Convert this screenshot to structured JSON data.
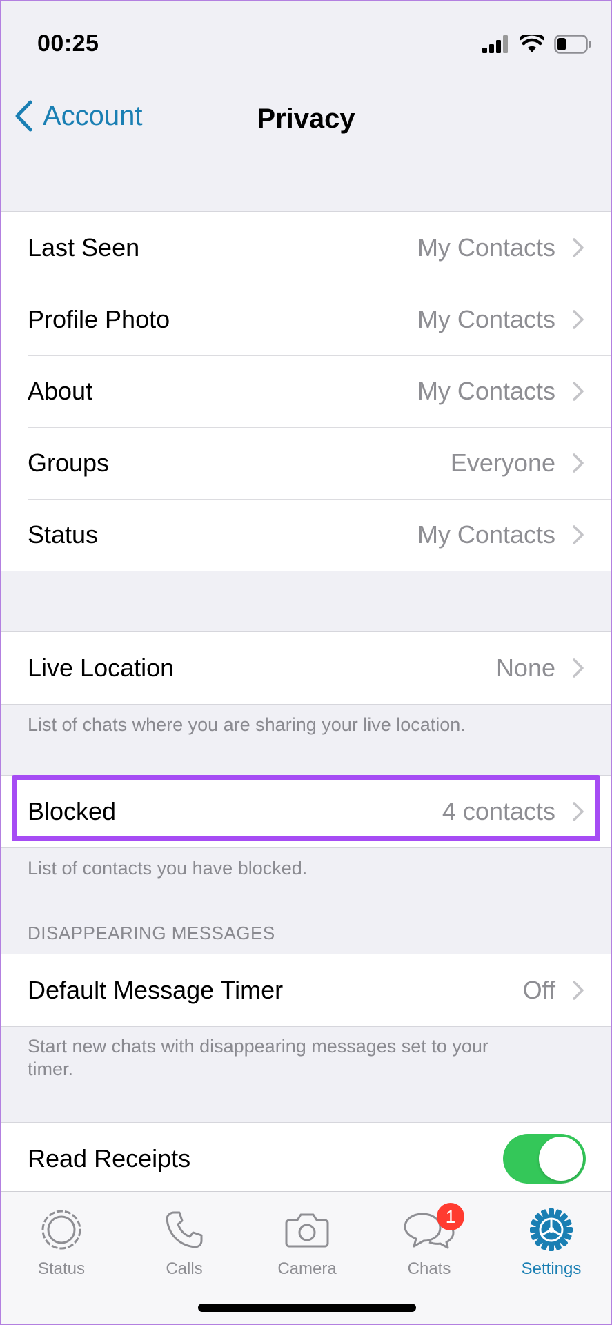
{
  "status_bar": {
    "time": "00:25"
  },
  "nav": {
    "back_label": "Account",
    "title": "Privacy"
  },
  "privacy_group": [
    {
      "label": "Last Seen",
      "value": "My Contacts"
    },
    {
      "label": "Profile Photo",
      "value": "My Contacts"
    },
    {
      "label": "About",
      "value": "My Contacts"
    },
    {
      "label": "Groups",
      "value": "Everyone"
    },
    {
      "label": "Status",
      "value": "My Contacts"
    }
  ],
  "live_location": {
    "label": "Live Location",
    "value": "None",
    "footnote": "List of chats where you are sharing your live location."
  },
  "blocked": {
    "label": "Blocked",
    "value": "4 contacts",
    "footnote": "List of contacts you have blocked."
  },
  "disappearing": {
    "header": "DISAPPEARING MESSAGES",
    "label": "Default Message Timer",
    "value": "Off",
    "footnote": "Start new chats with disappearing messages set to your timer."
  },
  "read_receipts": {
    "label": "Read Receipts",
    "enabled": true
  },
  "tabbar": {
    "tabs": [
      {
        "label": "Status"
      },
      {
        "label": "Calls"
      },
      {
        "label": "Camera"
      },
      {
        "label": "Chats",
        "badge": "1"
      },
      {
        "label": "Settings",
        "active": true
      }
    ]
  },
  "colors": {
    "accent": "#1a7fb3",
    "toggle_on": "#34c759",
    "highlight": "#a64cf4",
    "badge": "#ff3b30"
  }
}
